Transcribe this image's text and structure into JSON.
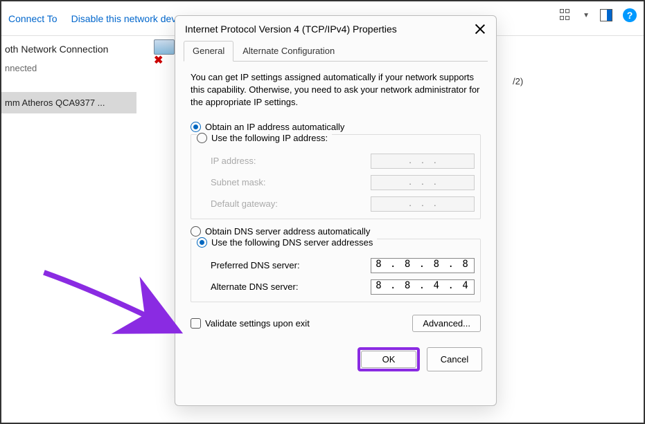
{
  "toolbar": {
    "connect_to": "Connect To",
    "disable": "Disable this network dev"
  },
  "bg": {
    "conn_name": "oth Network Connection",
    "status": "nnected",
    "hardware": "mm Atheros QCA9377 ...",
    "v2": "/2)"
  },
  "dialog": {
    "title": "Internet Protocol Version 4 (TCP/IPv4) Properties",
    "tabs": {
      "general": "General",
      "alt": "Alternate Configuration"
    },
    "intro": "You can get IP settings assigned automatically if your network supports this capability. Otherwise, you need to ask your network administrator for the appropriate IP settings.",
    "ip": {
      "auto": "Obtain an IP address automatically",
      "manual": "Use the following IP address:",
      "addr_label": "IP address:",
      "mask_label": "Subnet mask:",
      "gw_label": "Default gateway:"
    },
    "dns": {
      "auto": "Obtain DNS server address automatically",
      "manual": "Use the following DNS server addresses",
      "pref_label": "Preferred DNS server:",
      "alt_label": "Alternate DNS server:",
      "pref_value": "8 . 8 . 8 . 8",
      "alt_value": "8 . 8 . 4 . 4"
    },
    "validate": "Validate settings upon exit",
    "advanced": "Advanced...",
    "ok": "OK",
    "cancel": "Cancel"
  }
}
